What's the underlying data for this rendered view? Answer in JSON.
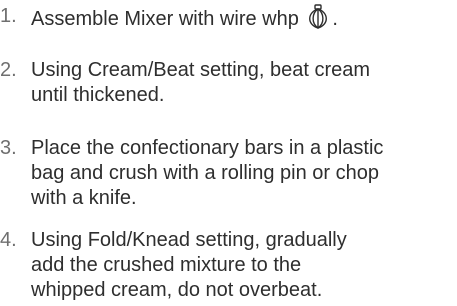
{
  "steps": [
    {
      "number": "1.",
      "lines": [
        "Assemble Mixer with wire whp",
        "."
      ],
      "icon": "wire-whisk-icon"
    },
    {
      "number": "2.",
      "lines": [
        "Using Cream/Beat setting, beat cream",
        "until thickened."
      ]
    },
    {
      "number": "3.",
      "lines": [
        "Place the confectionary bars in a plastic",
        "bag and crush with a rolling pin or chop",
        "with a knife."
      ]
    },
    {
      "number": "4.",
      "lines": [
        "Using Fold/Knead setting, gradually",
        "add the crushed mixture to the",
        "whipped cream, do not overbeat."
      ]
    }
  ]
}
